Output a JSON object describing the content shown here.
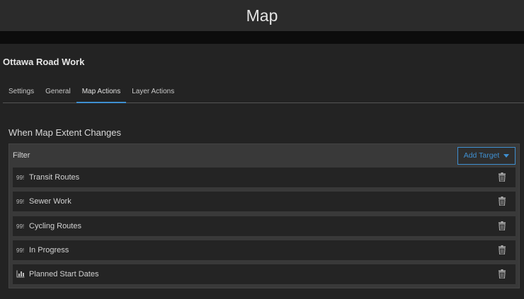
{
  "window_title": "Map",
  "panel_title": "Ottawa Road Work",
  "tabs": [
    {
      "label": "Settings"
    },
    {
      "label": "General"
    },
    {
      "label": "Map Actions",
      "active": true
    },
    {
      "label": "Layer Actions"
    }
  ],
  "section_heading": "When Map Extent Changes",
  "filter": {
    "label": "Filter",
    "add_target_label": "Add Target",
    "items": [
      {
        "icon": "99!",
        "icon_name": "feature-layer-icon",
        "label": "Transit Routes"
      },
      {
        "icon": "99!",
        "icon_name": "feature-layer-icon",
        "label": "Sewer Work"
      },
      {
        "icon": "99!",
        "icon_name": "feature-layer-icon",
        "label": "Cycling Routes"
      },
      {
        "icon": "99!",
        "icon_name": "feature-layer-icon",
        "label": "In Progress"
      },
      {
        "icon": "chart",
        "icon_name": "chart-icon",
        "label": "Planned Start Dates"
      }
    ]
  },
  "colors": {
    "accent": "#3f8fd0"
  }
}
